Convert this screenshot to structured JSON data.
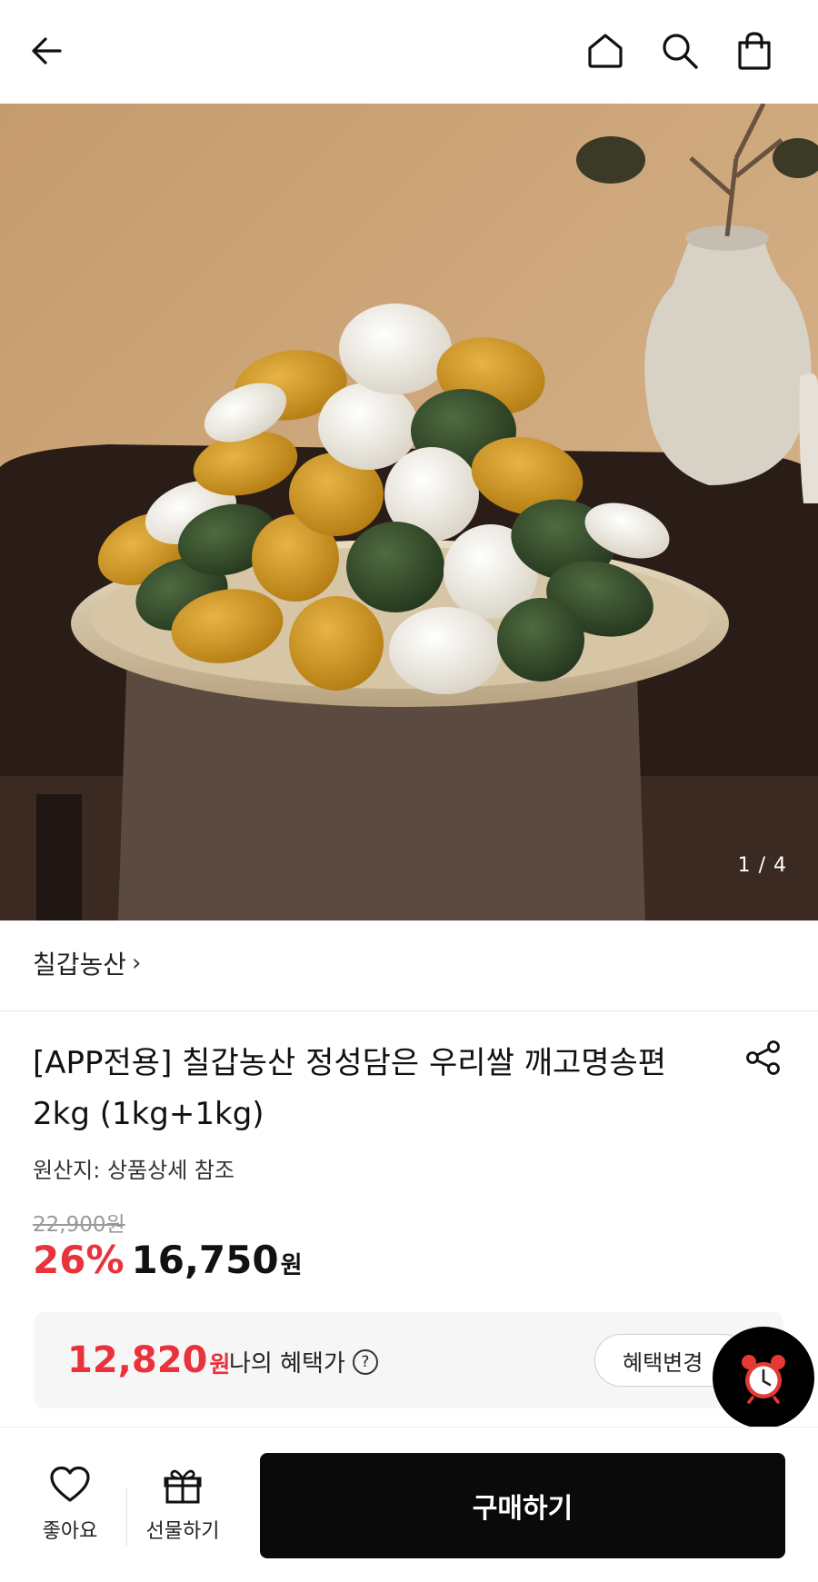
{
  "header": {
    "icons": [
      "back-arrow-icon",
      "home-icon",
      "search-icon",
      "shopping-bag-icon"
    ]
  },
  "gallery": {
    "counter": "1 / 4"
  },
  "product": {
    "brand": "칠갑농산",
    "brand_chevron": "›",
    "title": "[APP전용] 칠갑농산 정성담은 우리쌀 깨고명송편 2kg (1kg+1kg)",
    "origin": "원산지: 상품상세 참조",
    "original_price": "22,900원",
    "discount": "26%",
    "sale_price": "16,750",
    "sale_price_unit": "원"
  },
  "benefit": {
    "price": "12,820",
    "price_unit": "원",
    "label": "나의 혜택가",
    "help_glyph": "?",
    "change_button": "혜택변경"
  },
  "bottom_bar": {
    "like_label": "좋아요",
    "gift_label": "선물하기",
    "buy_label": "구매하기"
  },
  "colors": {
    "accent_red": "#e8323c",
    "buy_button": "#0a0a0a",
    "benefit_background": "#f6f6f6"
  }
}
